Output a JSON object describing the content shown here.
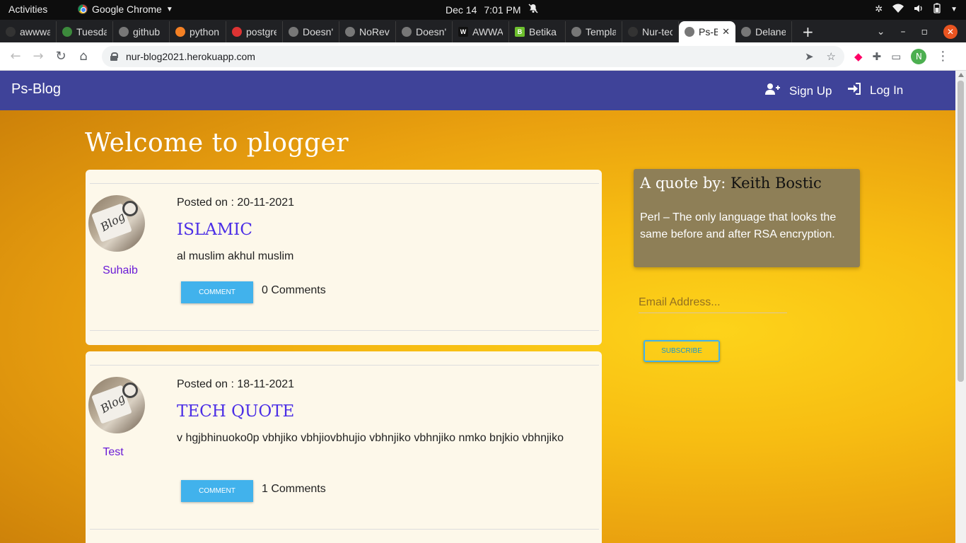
{
  "os_bar": {
    "activities": "Activities",
    "app_name": "Google Chrome",
    "date": "Dec 14",
    "time": "7:01 PM"
  },
  "tabs": [
    {
      "title": "awwwards",
      "favicon_color": "#333333"
    },
    {
      "title": "Tuesday",
      "favicon_color": "#3c8a3c"
    },
    {
      "title": "github",
      "favicon_color": "#777777"
    },
    {
      "title": "python",
      "favicon_color": "#f48024"
    },
    {
      "title": "postgres",
      "favicon_color": "#d33"
    },
    {
      "title": "Doesn't",
      "favicon_color": "#777777"
    },
    {
      "title": "NoReverse",
      "favicon_color": "#777777"
    },
    {
      "title": "Doesn't",
      "favicon_color": "#777777"
    },
    {
      "title": "AWWARDS",
      "favicon_color": "#111111"
    },
    {
      "title": "Betika",
      "favicon_color": "#6dbf2e"
    },
    {
      "title": "Template",
      "favicon_color": "#777777"
    },
    {
      "title": "Nur-tech",
      "favicon_color": "#333333"
    },
    {
      "title": "Ps-Blog",
      "favicon_color": "#777777",
      "active": true
    },
    {
      "title": "Delaney",
      "favicon_color": "#777777"
    }
  ],
  "address_bar": {
    "url": "nur-blog2021.herokuapp.com",
    "profile_initial": "N"
  },
  "site": {
    "brand": "Ps-Blog",
    "signup": "Sign Up",
    "login": "Log In",
    "heading": "Welcome to plogger"
  },
  "posts": [
    {
      "author": "Suhaib",
      "posted": "Posted on : 20-11-2021",
      "title": "ISLAMIC",
      "body": "al muslim akhul muslim",
      "comment_button": "COMMENT",
      "comment_count": "0 Comments"
    },
    {
      "author": "Test",
      "posted": "Posted on : 18-11-2021",
      "title": "TECH QUOTE",
      "body": "v hgjbhinuoko0p vbhjiko vbhjiovbhujio vbhnjiko vbhnjiko nmko bnjkio vbhnjiko",
      "comment_button": "COMMENT",
      "comment_count": "1 Comments"
    }
  ],
  "quote": {
    "prefix": "A quote by: ",
    "author": "Keith Bostic",
    "text": "Perl – The only language that looks the same before and after RSA encryption."
  },
  "newsletter": {
    "email_placeholder": "Email Address...",
    "subscribe_label": "SUBSCRIBE"
  },
  "colors": {
    "navbar": "#3f4399",
    "accent_button": "#41b2ec",
    "post_title": "#4b2ee6",
    "author": "#6a1bd6",
    "quote_card": "#8e7f57"
  }
}
